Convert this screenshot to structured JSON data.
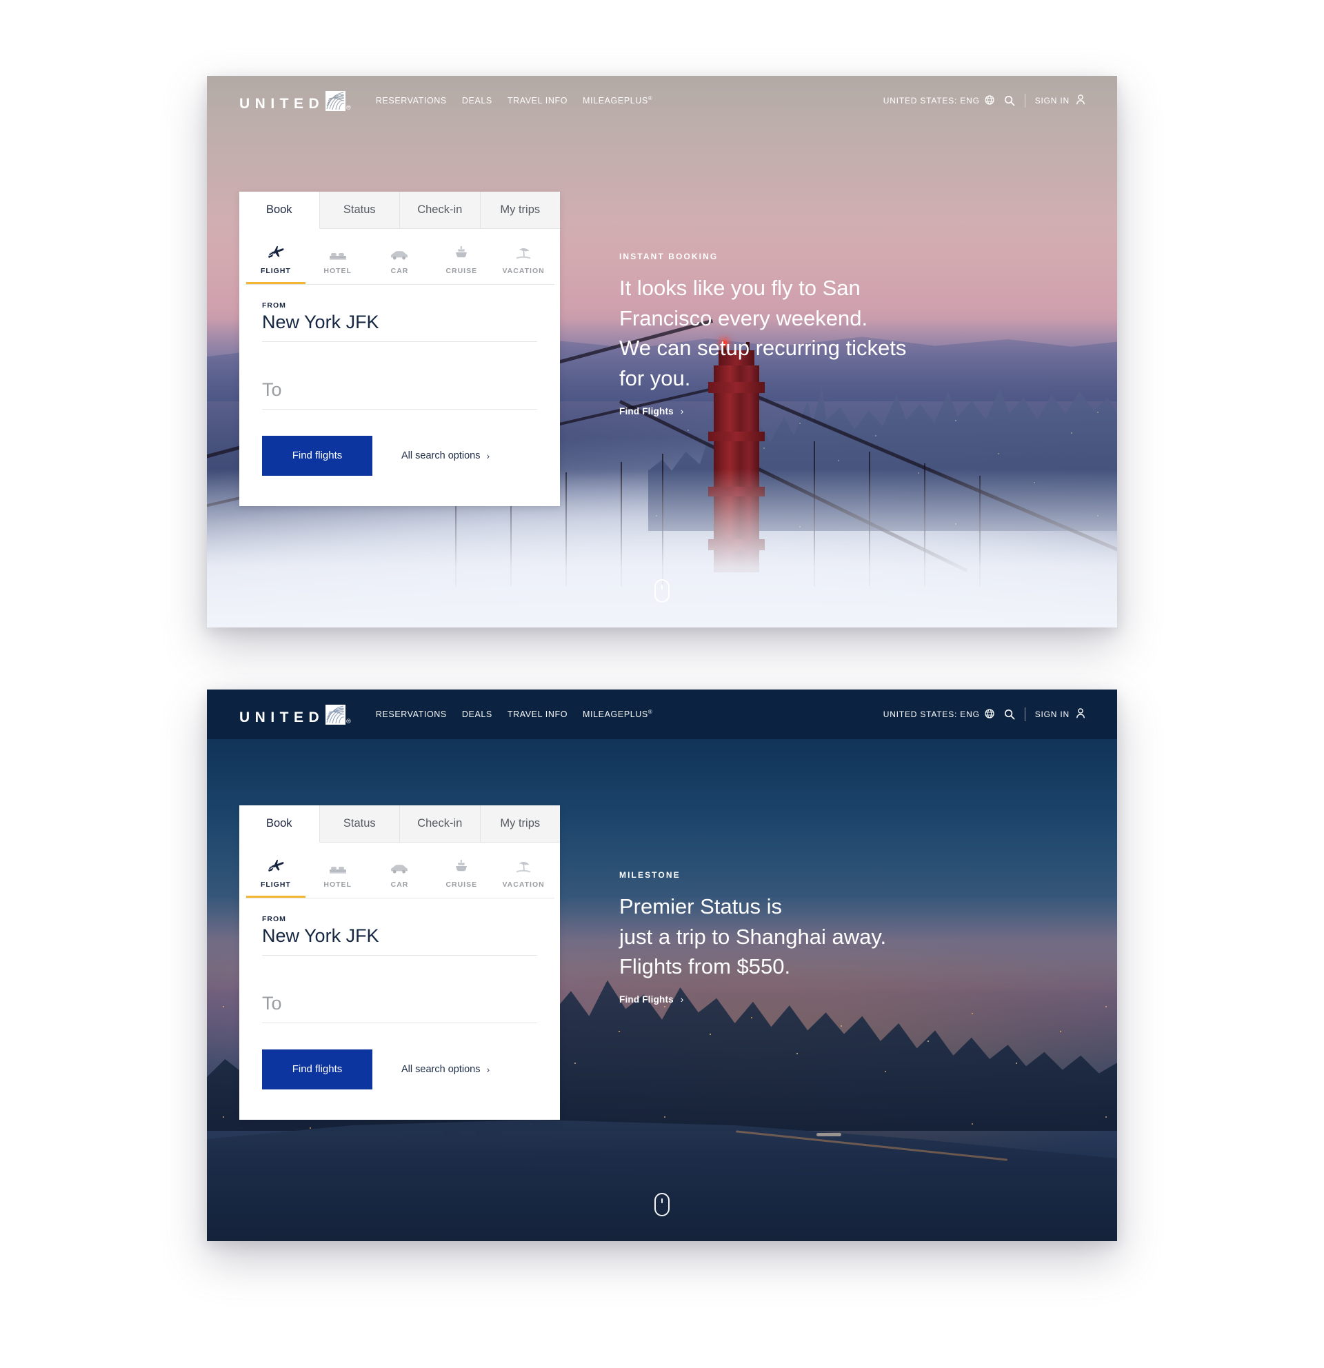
{
  "brand": {
    "wordmark": "UNITED",
    "registered": "®",
    "logo_icon": "globe-stripes-logo"
  },
  "header": {
    "nav": [
      {
        "label": "RESERVATIONS",
        "name": "nav-reservations"
      },
      {
        "label": "DEALS",
        "name": "nav-deals"
      },
      {
        "label": "TRAVEL INFO",
        "name": "nav-travel-info"
      },
      {
        "label": "MILEAGEPLUS",
        "sup": "®",
        "name": "nav-mileageplus"
      }
    ],
    "locale": "UNITED STATES: ENG",
    "locale_icon": "globe-icon",
    "search_icon": "search-icon",
    "sign_in": "SIGN IN",
    "sign_in_icon": "person-icon"
  },
  "booking": {
    "tabs": [
      {
        "label": "Book",
        "active": true
      },
      {
        "label": "Status",
        "active": false
      },
      {
        "label": "Check-in",
        "active": false
      },
      {
        "label": "My trips",
        "active": false
      }
    ],
    "modes": [
      {
        "label": "FLIGHT",
        "icon": "airplane-icon",
        "active": true
      },
      {
        "label": "HOTEL",
        "icon": "bed-icon",
        "active": false
      },
      {
        "label": "CAR",
        "icon": "car-icon",
        "active": false
      },
      {
        "label": "CRUISE",
        "icon": "ship-icon",
        "active": false
      },
      {
        "label": "VACATION",
        "icon": "palm-umbrella-icon",
        "active": false
      }
    ],
    "from_label": "FROM",
    "from_value": "New York JFK",
    "to_placeholder": "To",
    "to_value": "",
    "find_flights_label": "Find flights",
    "all_search_options_label": "All search options",
    "chevron": "›"
  },
  "panels": [
    {
      "id": "panel-instant-booking",
      "theme": "sunset",
      "header_style": "transparent",
      "eyebrow": "INSTANT BOOKING",
      "headline_lines": [
        "It looks like you fly to San",
        "Francisco every weekend.",
        "We can setup recurring tickets",
        "for you."
      ],
      "cta_label": "Find Flights",
      "scroll_indicator": "mouse-scroll-icon"
    },
    {
      "id": "panel-milestone",
      "theme": "night",
      "header_style": "navy",
      "eyebrow": "MILESTONE",
      "headline_lines": [
        "Premier Status is",
        "just a trip to Shanghai away.",
        "Flights from $550."
      ],
      "cta_label": "Find Flights",
      "scroll_indicator": "mouse-scroll-icon"
    }
  ],
  "colors": {
    "brand_navy": "#0b2340",
    "button_blue": "#0c35a0",
    "accent_gold": "#f2b632",
    "text_dark": "#152742",
    "muted": "#9a9da2"
  }
}
